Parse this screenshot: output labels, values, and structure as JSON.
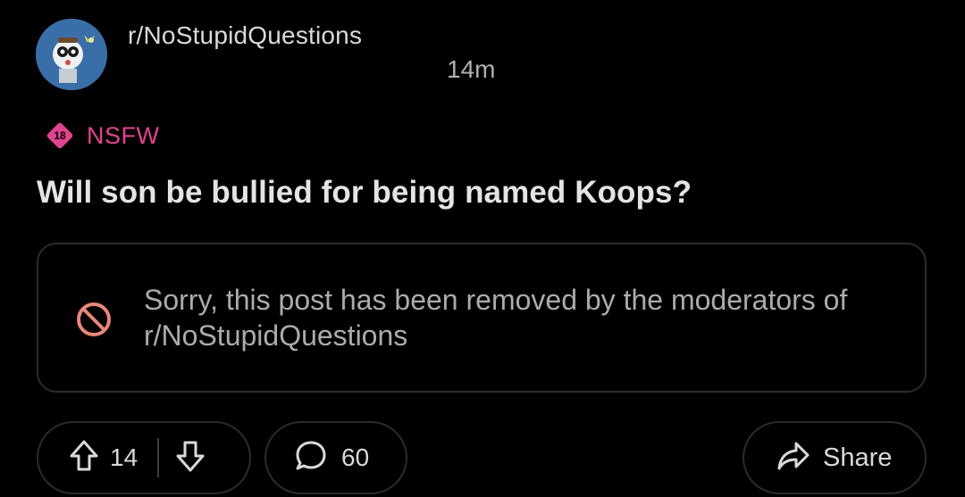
{
  "header": {
    "subreddit": "r/NoStupidQuestions",
    "timestamp": "14m"
  },
  "post": {
    "nsfw_badge_number": "18",
    "nsfw_label": "NSFW",
    "title": "Will son be bullied for being named Koops?",
    "removed_notice": "Sorry, this post has been removed by the moderators of r/NoStupidQuestions"
  },
  "actions": {
    "votes": "14",
    "comments": "60",
    "share_label": "Share"
  },
  "icons": {
    "avatar": "subreddit-avatar",
    "nsfw": "nsfw-badge-icon",
    "removed": "prohibited-icon",
    "upvote": "upvote-arrow-icon",
    "downvote": "downvote-arrow-icon",
    "comment": "comment-bubble-icon",
    "share": "share-arrow-icon"
  },
  "colors": {
    "background": "#000000",
    "nsfw_accent": "#e0448f",
    "removed_icon": "#e8887a",
    "border": "#2a2c2e",
    "text_primary": "#e2e4e6",
    "text_secondary": "#a9acaf"
  }
}
